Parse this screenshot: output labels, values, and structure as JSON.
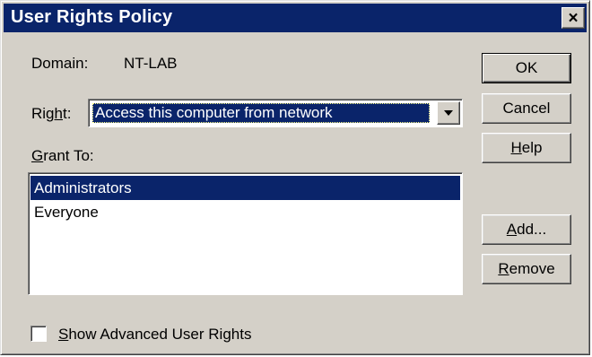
{
  "window": {
    "title": "User Rights Policy",
    "close_glyph": "×",
    "colors": {
      "titlebar": "#0a246a",
      "face": "#d4d0c8",
      "selection": "#0a246a"
    }
  },
  "domain": {
    "label": "Domain:",
    "value": "NT-LAB"
  },
  "right": {
    "label_prefix": "Rig",
    "label_underlined": "h",
    "label_suffix": "t:",
    "selected_value": "Access this computer from network",
    "dropdown_icon": "chevron-down-icon"
  },
  "grant_to": {
    "label_underlined": "G",
    "label_rest": "rant To:",
    "items": [
      {
        "label": "Administrators",
        "selected": true
      },
      {
        "label": "Everyone",
        "selected": false
      }
    ]
  },
  "buttons": {
    "ok": {
      "label": "OK"
    },
    "cancel": {
      "label": "Cancel"
    },
    "help": {
      "underlined": "H",
      "rest": "elp"
    },
    "add": {
      "underlined": "A",
      "rest": "dd..."
    },
    "remove": {
      "underlined": "R",
      "rest": "emove"
    }
  },
  "advanced": {
    "checked": false,
    "label_underlined": "S",
    "label_rest": "how Advanced User Rights"
  }
}
